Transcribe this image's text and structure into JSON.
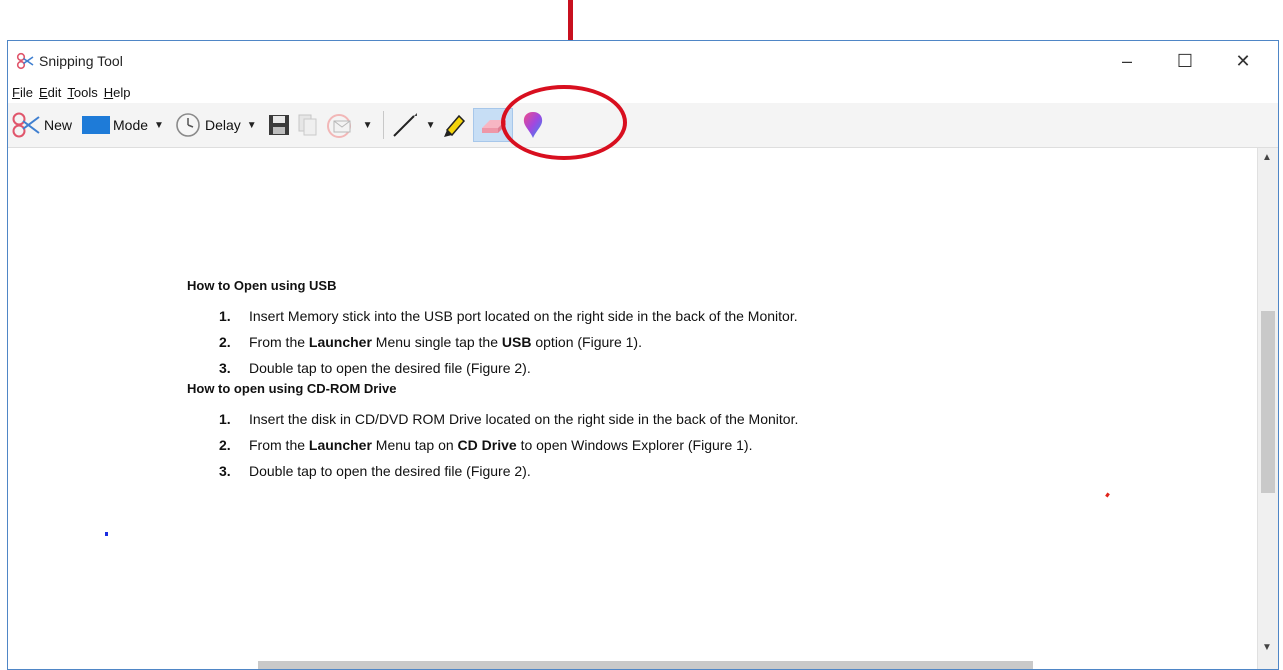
{
  "window": {
    "title": "Snipping Tool",
    "controls": {
      "minimize": "–",
      "maximize": "☐",
      "close": "✕"
    }
  },
  "menu": [
    "File",
    "Edit",
    "Tools",
    "Help"
  ],
  "toolbar": {
    "new_label": "New",
    "mode_label": "Mode",
    "delay_label": "Delay"
  },
  "icons": {
    "app": "scissors-icon",
    "new": "scissors-icon",
    "mode": "mode-rectangle-icon",
    "delay": "clock-icon",
    "save": "floppy-disk-icon",
    "copy": "copy-icon",
    "send": "envelope-icon",
    "pen": "pen-icon",
    "highlighter": "highlighter-icon",
    "eraser": "eraser-icon",
    "paint3d": "paint-3d-icon"
  },
  "colors": {
    "annotation_red": "#d80f1f",
    "window_border": "#4f86c6",
    "selected_tool_bg": "#c7def5"
  },
  "document": {
    "section1": {
      "title": "How to Open using USB",
      "steps": [
        {
          "num": "1.",
          "parts": [
            {
              "t": "Insert Memory stick into the USB port located on the right side in the back of the Monitor.",
              "b": false
            }
          ]
        },
        {
          "num": "2.",
          "parts": [
            {
              "t": "From the ",
              "b": false
            },
            {
              "t": "Launcher",
              "b": true
            },
            {
              "t": " Menu single tap the ",
              "b": false
            },
            {
              "t": "USB",
              "b": true
            },
            {
              "t": " option (Figure 1).",
              "b": false
            }
          ]
        },
        {
          "num": "3.",
          "parts": [
            {
              "t": "Double tap to open the desired file (Figure 2).",
              "b": false
            }
          ]
        }
      ]
    },
    "section2": {
      "title": "How to open using CD-ROM Drive",
      "steps": [
        {
          "num": "1.",
          "parts": [
            {
              "t": "Insert the disk in CD/DVD ROM Drive located on the right side in the back of the Monitor.",
              "b": false
            }
          ]
        },
        {
          "num": "2.",
          "parts": [
            {
              "t": "From the ",
              "b": false
            },
            {
              "t": "Launcher",
              "b": true
            },
            {
              "t": " Menu tap on ",
              "b": false
            },
            {
              "t": "CD Drive",
              "b": true
            },
            {
              "t": " to open Windows Explorer (Figure 1).",
              "b": false
            }
          ]
        },
        {
          "num": "3.",
          "parts": [
            {
              "t": "Double tap to open the desired file (Figure 2).",
              "b": false
            }
          ]
        }
      ]
    }
  }
}
